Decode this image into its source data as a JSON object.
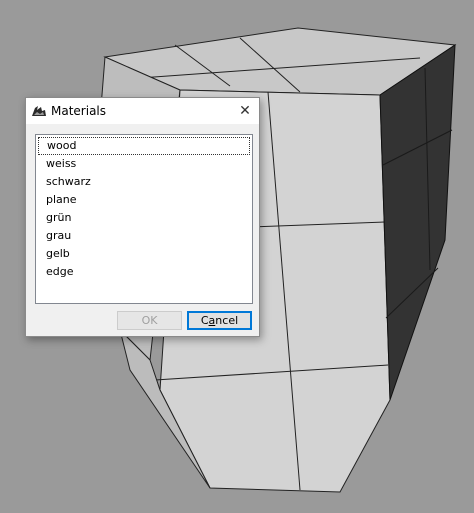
{
  "dialog": {
    "title": "Materials",
    "close_glyph": "✕",
    "list_items": [
      "wood",
      "weiss",
      "schwarz",
      "plane",
      "grün",
      "grau",
      "gelb",
      "edge"
    ],
    "focused_index": 0,
    "ok_label": "OK",
    "cancel_label": "Cancel",
    "ok_enabled": false
  },
  "icons": {
    "app": "rhino-app-icon",
    "close": "close-icon"
  },
  "colors": {
    "background": "#9a9a9a",
    "face_light": "#d4d4d4",
    "face_mid": "#c4c4c4",
    "face_dark": "#333333",
    "accent": "#0078d7"
  }
}
